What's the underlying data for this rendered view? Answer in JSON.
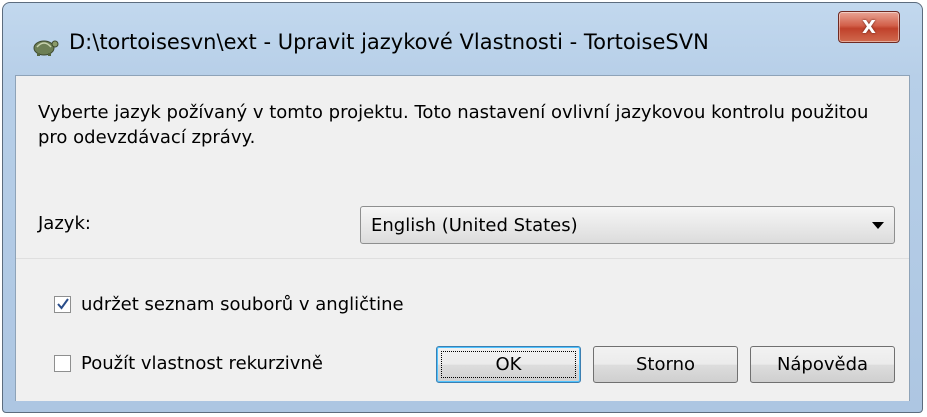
{
  "window": {
    "title": "D:\\tortoisesvn\\ext - Upravit jazykové Vlastnosti - TortoiseSVN",
    "close_glyph": "X",
    "icon": "tortoise-icon"
  },
  "description": "Vyberte jazyk požívaný v tomto projektu. Toto nastavení ovlivní jazykovou kontrolu použitou pro odevzdávací zprávy.",
  "language": {
    "label": "Jazyk:",
    "selected": "English (United States)"
  },
  "options": {
    "keep_english_filelist": {
      "label": "udržet seznam souborů v angličtine",
      "checked": true
    },
    "recursive": {
      "label": "Použít vlastnost rekurzivně",
      "checked": false
    }
  },
  "buttons": {
    "ok": "OK",
    "cancel": "Storno",
    "help": "Nápověda"
  },
  "colors": {
    "close_button": "#c84a34",
    "focus_border": "#4fc3ff"
  }
}
